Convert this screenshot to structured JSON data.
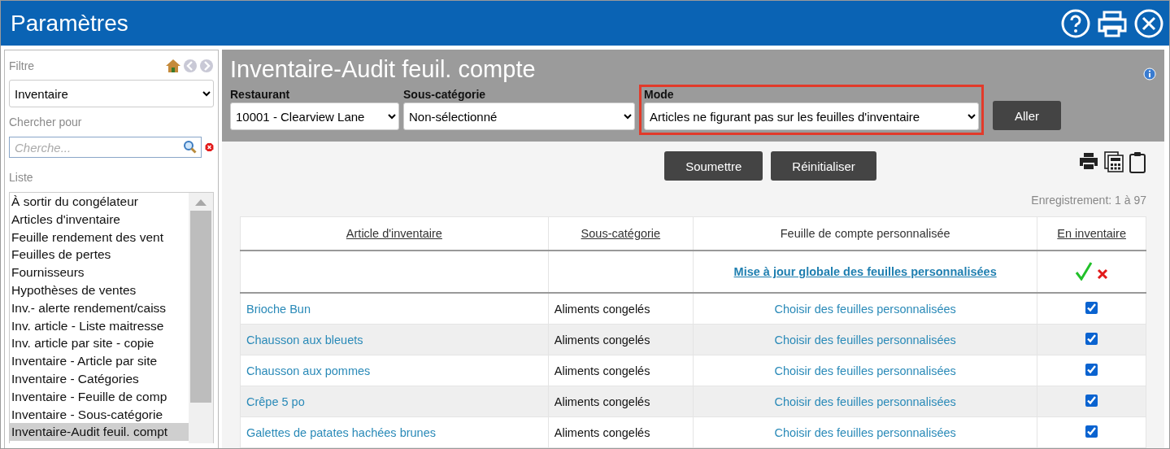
{
  "window": {
    "title": "Paramètres"
  },
  "sidebar": {
    "filter_label": "Filtre",
    "filter_value": "Inventaire",
    "search_label": "Chercher pour",
    "search": {
      "placeholder": "Cherche..."
    },
    "list_label": "Liste",
    "items": [
      {
        "label": "À sortir du congélateur",
        "selected": false
      },
      {
        "label": "Articles d'inventaire",
        "selected": false
      },
      {
        "label": "Feuille rendement des vent",
        "selected": false
      },
      {
        "label": "Feuilles de pertes",
        "selected": false
      },
      {
        "label": "Fournisseurs",
        "selected": false
      },
      {
        "label": "Hypothèses de ventes",
        "selected": false
      },
      {
        "label": "Inv.- alerte rendement/caiss",
        "selected": false
      },
      {
        "label": "Inv. article - Liste maitresse",
        "selected": false
      },
      {
        "label": "Inv. article par site - copie",
        "selected": false
      },
      {
        "label": "Inventaire - Article par site",
        "selected": false
      },
      {
        "label": "Inventaire - Catégories",
        "selected": false
      },
      {
        "label": "Inventaire - Feuille de comp",
        "selected": false
      },
      {
        "label": "Inventaire - Sous-catégorie",
        "selected": false
      },
      {
        "label": "Inventaire-Audit feuil. compt",
        "selected": true
      }
    ]
  },
  "page": {
    "title": "Inventaire-Audit feuil. compte",
    "filters": [
      {
        "label": "Restaurant",
        "value": "10001 - Clearview Lane",
        "highlighted": false
      },
      {
        "label": "Sous-catégorie",
        "value": "Non-sélectionné",
        "highlighted": false
      },
      {
        "label": "Mode",
        "value": "Articles ne figurant pas sur les feuilles d'inventaire",
        "highlighted": true
      }
    ],
    "go_button": "Aller",
    "buttons": [
      "Soumettre",
      "Réinitialiser"
    ],
    "record_count": "Enregistrement: 1 à 97"
  },
  "table": {
    "columns": [
      {
        "label": "Article d'inventaire",
        "sortable": true
      },
      {
        "label": "Sous-catégorie",
        "sortable": true
      },
      {
        "label": "Feuille de compte personnalisée",
        "sortable": false
      },
      {
        "label": "En inventaire",
        "sortable": true
      }
    ],
    "global_update_link": "Mise à jour globale des feuilles personnalisées",
    "rows": [
      {
        "item": "Brioche Bun",
        "subcategory": "Aliments congelés",
        "sheets_link": "Choisir des feuilles personnalisées",
        "in_inventory": true
      },
      {
        "item": "Chausson aux bleuets",
        "subcategory": "Aliments congelés",
        "sheets_link": "Choisir des feuilles personnalisées",
        "in_inventory": true
      },
      {
        "item": "Chausson aux pommes",
        "subcategory": "Aliments congelés",
        "sheets_link": "Choisir des feuilles personnalisées",
        "in_inventory": true
      },
      {
        "item": "Crêpe 5 po",
        "subcategory": "Aliments congelés",
        "sheets_link": "Choisir des feuilles personnalisées",
        "in_inventory": true
      },
      {
        "item": "Galettes de patates hachées brunes",
        "subcategory": "Aliments congelés",
        "sheets_link": "Choisir des feuilles personnalisées",
        "in_inventory": true
      }
    ]
  }
}
